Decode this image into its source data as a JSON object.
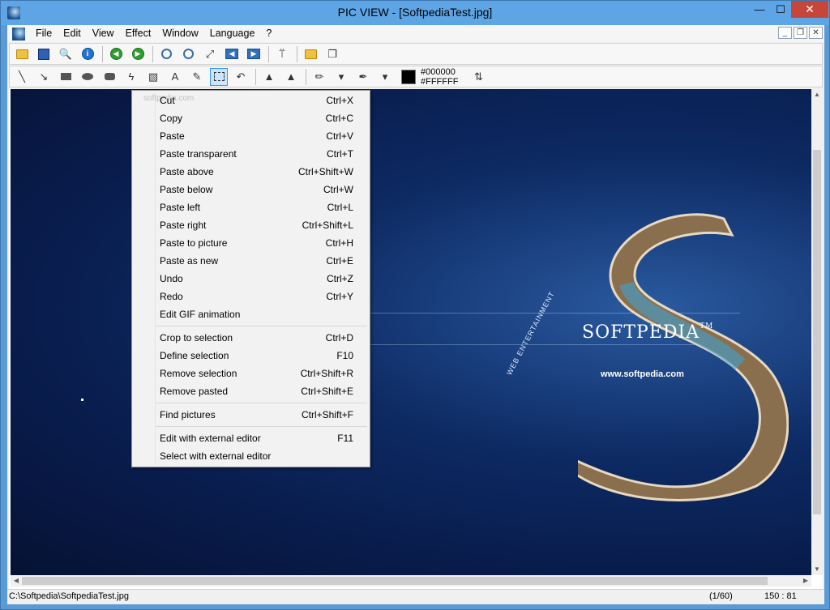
{
  "window": {
    "title": "PIC VIEW  - [SoftpediaTest.jpg]",
    "minimize": "—",
    "maximize": "☐",
    "close": "✕"
  },
  "menubar": {
    "items": [
      "File",
      "Edit",
      "View",
      "Effect",
      "Window",
      "Language",
      "?"
    ]
  },
  "mdi": {
    "minimize": "_",
    "restore": "❐",
    "close": "✕"
  },
  "toolbar2": {
    "fg_color": "#000000",
    "bg_color": "#FFFFFF"
  },
  "image": {
    "logo_text": "SOFTPEDIA",
    "logo_tm": "TM",
    "url_text": "www.softpedia.com",
    "side_text": "WEB ENTERTAINMENT"
  },
  "context_menu": {
    "watermark": "softpedia.com",
    "items": [
      {
        "label": "Cut",
        "shortcut": "Ctrl+X"
      },
      {
        "label": "Copy",
        "shortcut": "Ctrl+C"
      },
      {
        "label": "Paste",
        "shortcut": "Ctrl+V"
      },
      {
        "label": "Paste transparent",
        "shortcut": "Ctrl+T"
      },
      {
        "label": "Paste above",
        "shortcut": "Ctrl+Shift+W"
      },
      {
        "label": "Paste below",
        "shortcut": "Ctrl+W"
      },
      {
        "label": "Paste left",
        "shortcut": "Ctrl+L"
      },
      {
        "label": "Paste right",
        "shortcut": "Ctrl+Shift+L"
      },
      {
        "label": "Paste to picture",
        "shortcut": "Ctrl+H"
      },
      {
        "label": "Paste as new",
        "shortcut": "Ctrl+E"
      },
      {
        "label": "Undo",
        "shortcut": "Ctrl+Z"
      },
      {
        "label": "Redo",
        "shortcut": "Ctrl+Y"
      },
      {
        "label": "Edit GIF animation",
        "shortcut": ""
      },
      {
        "label": "Crop to selection",
        "shortcut": "Ctrl+D"
      },
      {
        "label": "Define selection",
        "shortcut": "F10"
      },
      {
        "label": "Remove selection",
        "shortcut": "Ctrl+Shift+R"
      },
      {
        "label": "Remove pasted",
        "shortcut": "Ctrl+Shift+E"
      },
      {
        "label": "Find pictures",
        "shortcut": "Ctrl+Shift+F"
      },
      {
        "label": "Edit with external editor",
        "shortcut": "F11"
      },
      {
        "label": "Select with external editor",
        "shortcut": ""
      }
    ]
  },
  "statusbar": {
    "path": "C:\\Softpedia\\SoftpediaTest.jpg",
    "position": "(1/60)",
    "coords": "150 : 81"
  }
}
